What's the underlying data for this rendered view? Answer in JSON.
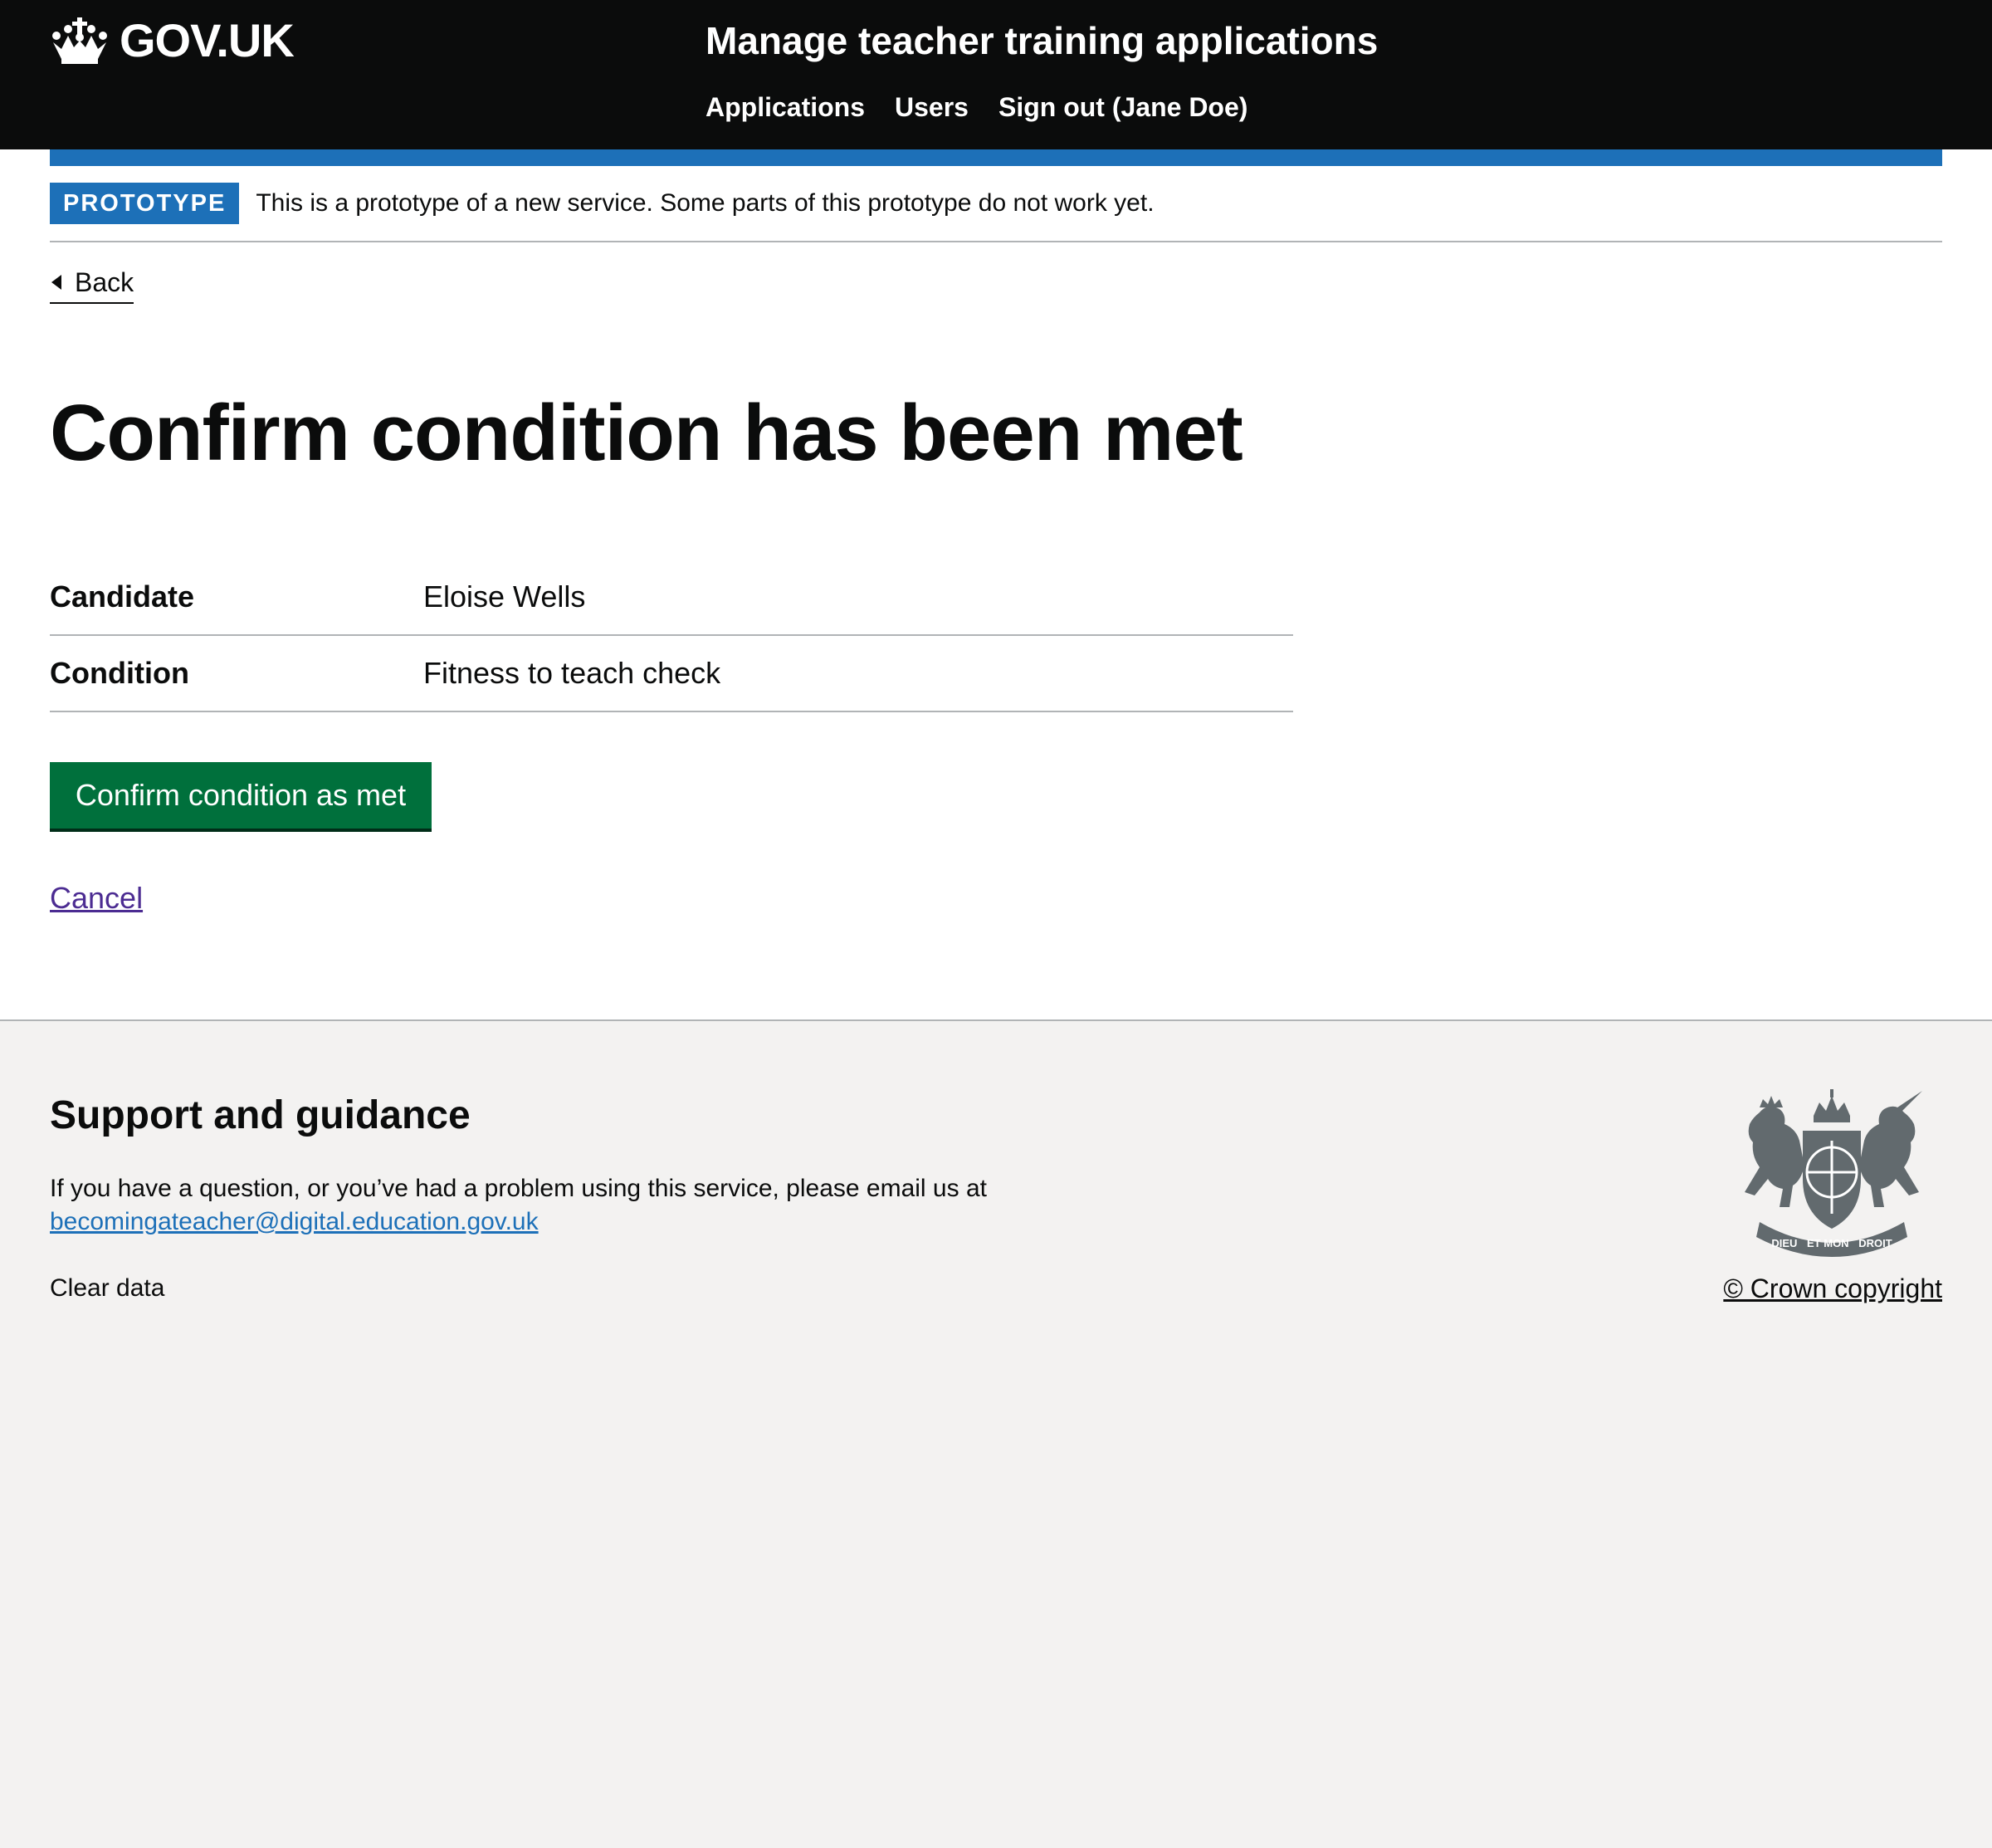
{
  "header": {
    "logo_text": "GOV.UK",
    "service_name": "Manage teacher training applications",
    "nav": [
      {
        "label": "Applications"
      },
      {
        "label": "Users"
      },
      {
        "label": "Sign out (Jane Doe)"
      }
    ]
  },
  "phase_banner": {
    "tag": "PROTOTYPE",
    "text": "This is a prototype of a new service. Some parts of this prototype do not work yet."
  },
  "back_link": "Back",
  "page_title": "Confirm condition has been met",
  "summary": [
    {
      "key": "Candidate",
      "value": "Eloise Wells"
    },
    {
      "key": "Condition",
      "value": "Fitness to teach check"
    }
  ],
  "confirm_button": "Confirm condition as met",
  "cancel_link": "Cancel",
  "footer": {
    "heading": "Support and guidance",
    "text": "If you have a question, or you’ve had a problem using this service, please email us at",
    "email": "becomingateacher@digital.education.gov.uk",
    "clear_data": "Clear data",
    "copyright": "© Crown copyright",
    "crest_motto": [
      "DIEU",
      "ET MON",
      "DROIT"
    ]
  },
  "colors": {
    "header_bg": "#0b0c0c",
    "brand_blue": "#1d70b8",
    "button_green": "#00703c",
    "visited_link": "#4c2c92",
    "footer_bg": "#f3f2f1"
  }
}
